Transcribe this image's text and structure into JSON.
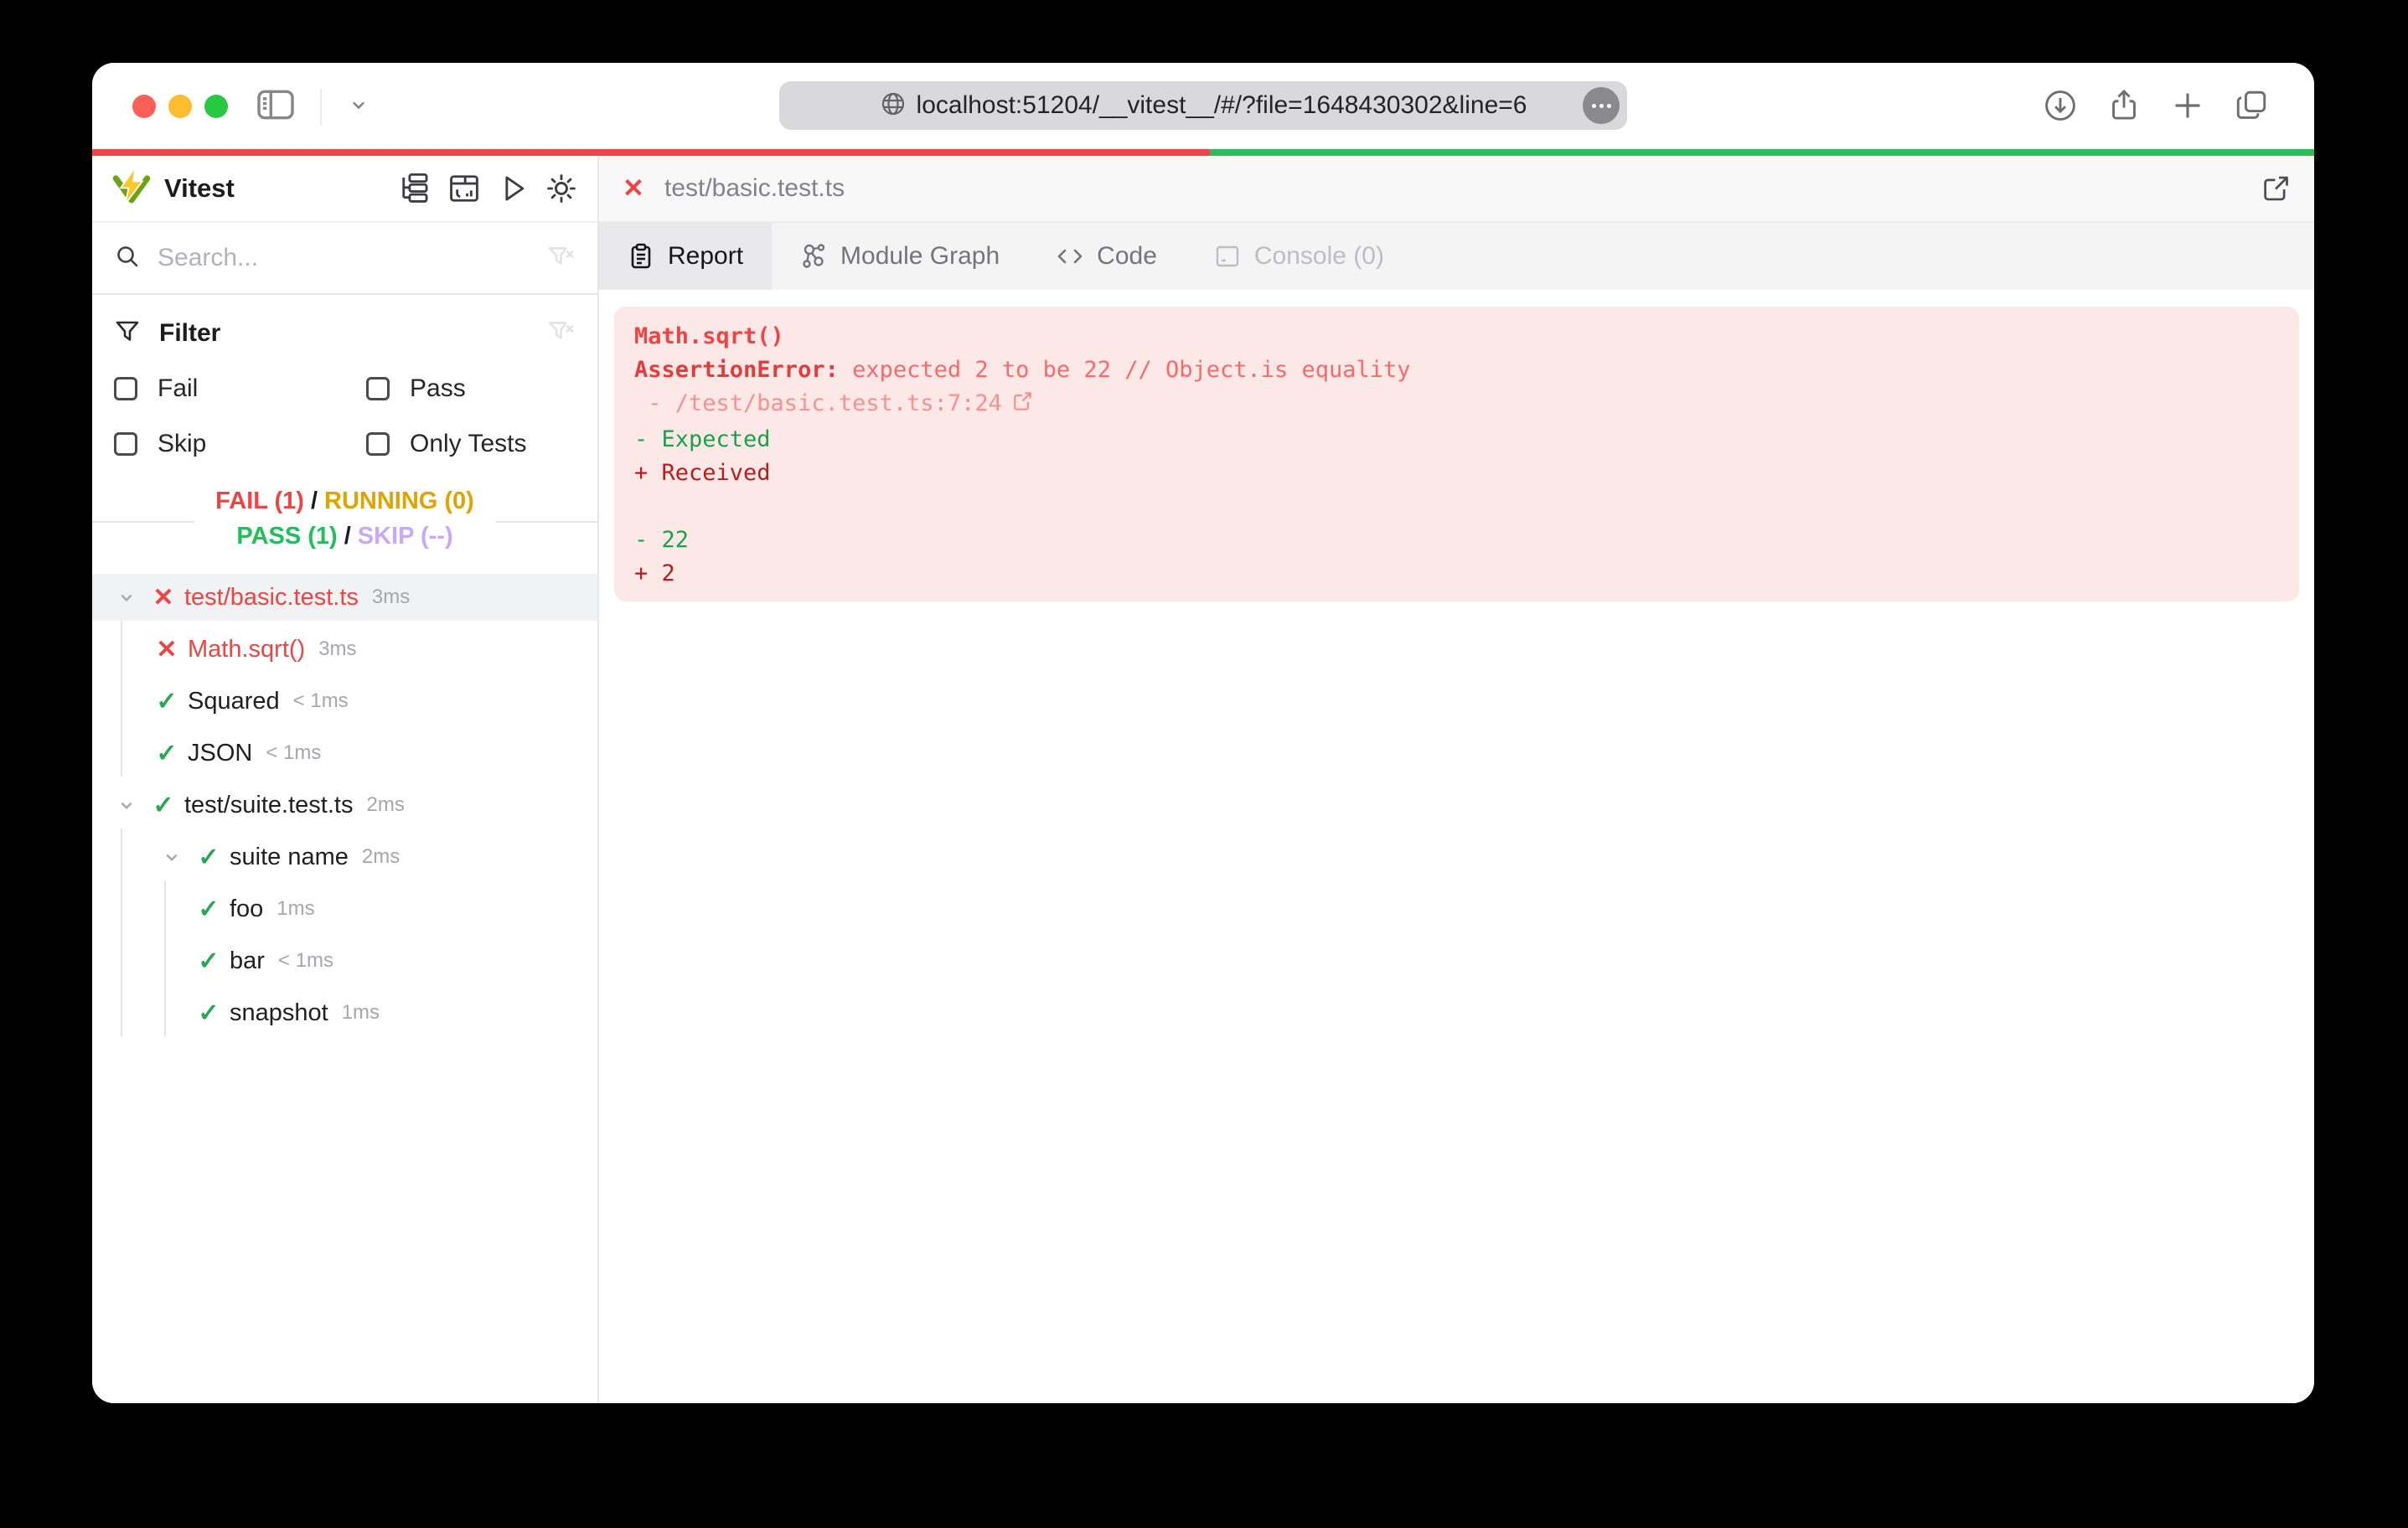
{
  "icons": {
    "fail": "✕",
    "pass": "✓"
  },
  "colors": {
    "fail": "#ef4444",
    "pass": "#27a653",
    "running": "#dfa400",
    "skip": "#c9a8fa",
    "progress_red": "#f14545",
    "progress_green": "#2dbe56",
    "error_bg": "#fde8e8"
  },
  "browser": {
    "url": "localhost:51204/__vitest__/#/?file=1648430302&line=6"
  },
  "header": {
    "app_name": "Vitest"
  },
  "search": {
    "placeholder": "Search..."
  },
  "filter": {
    "title": "Filter",
    "fail": "Fail",
    "pass": "Pass",
    "skip": "Skip",
    "only_tests": "Only Tests"
  },
  "summary": {
    "fail": "FAIL (1)",
    "running": "RUNNING (0)",
    "pass": "PASS (1)",
    "skip": "SKIP (--)",
    "separator": "/"
  },
  "tree": [
    {
      "name": "test/basic.test.ts",
      "duration": "3ms",
      "status": "fail"
    },
    {
      "name": "Math.sqrt()",
      "duration": "3ms",
      "status": "fail"
    },
    {
      "name": "Squared",
      "duration": "< 1ms",
      "status": "pass"
    },
    {
      "name": "JSON",
      "duration": "< 1ms",
      "status": "pass"
    },
    {
      "name": "test/suite.test.ts",
      "duration": "2ms",
      "status": "pass"
    },
    {
      "name": "suite name",
      "duration": "2ms",
      "status": "pass"
    },
    {
      "name": "foo",
      "duration": "1ms",
      "status": "pass"
    },
    {
      "name": "bar",
      "duration": "< 1ms",
      "status": "pass"
    },
    {
      "name": "snapshot",
      "duration": "1ms",
      "status": "pass"
    }
  ],
  "file_tab": {
    "label": "test/basic.test.ts"
  },
  "tabs": {
    "report": "Report",
    "module_graph": "Module Graph",
    "code": "Code",
    "console": "Console (0)"
  },
  "report": {
    "title": "Math.sqrt()",
    "error_label": "AssertionError: ",
    "error_message": "expected 2 to be 22 // Object.is equality",
    "stack_line": " - /test/basic.test.ts:7:24",
    "expected_label": "- Expected",
    "received_label": "+ Received",
    "expected_value": "- 22",
    "received_value": "+ 2"
  }
}
